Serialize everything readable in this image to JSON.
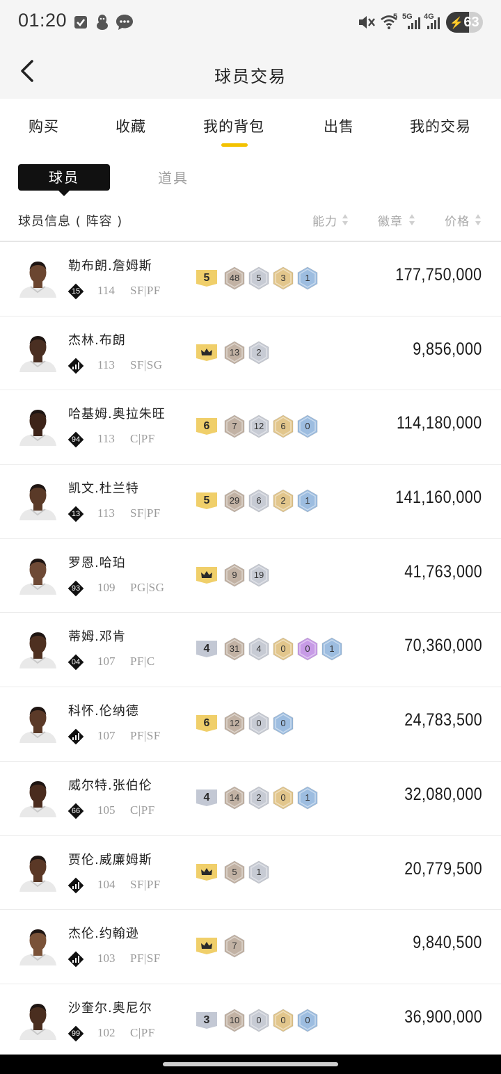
{
  "status_bar": {
    "time": "01:20",
    "battery": "63",
    "battery_level": 0.63,
    "net_5g": "5G",
    "net_4g": "4G",
    "wifi_badge": "5",
    "icons": [
      "checkbox-icon",
      "penguin-icon",
      "chat-icon",
      "mute-icon",
      "wifi-icon",
      "signal-5g-icon",
      "signal-4g-icon",
      "battery-charging-icon"
    ]
  },
  "header": {
    "title": "球员交易",
    "back_icon": "chevron-left-icon"
  },
  "tabs": [
    {
      "label": "购买"
    },
    {
      "label": "收藏"
    },
    {
      "label": "我的背包",
      "active": true
    },
    {
      "label": "出售"
    },
    {
      "label": "我的交易"
    }
  ],
  "sub_tabs": [
    {
      "label": "球员",
      "active": true
    },
    {
      "label": "道具"
    }
  ],
  "list_header": {
    "info": "球员信息 ( 阵容 )",
    "ability": "能力",
    "badge": "徽章",
    "price": "价格"
  },
  "colors": {
    "accent": "#f3c200",
    "level_gold": "#f0cf6a",
    "level_silver": "#c3c8d4",
    "hex_bronze": "#c2b2a4",
    "hex_silver": "#c7cbd4",
    "hex_gold": "#e2c68c",
    "hex_purple": "#c79be6",
    "hex_blue": "#9dbde0"
  },
  "players": [
    {
      "name": "勒布朗.詹姆斯",
      "jersey": "15",
      "ability": "114",
      "positions": "SF|PF",
      "level": "5",
      "level_type": "gold",
      "badges": [
        {
          "v": "48",
          "c": "bronze"
        },
        {
          "v": "5",
          "c": "silver"
        },
        {
          "v": "3",
          "c": "gold"
        },
        {
          "v": "1",
          "c": "blue"
        }
      ],
      "price": "177,750,000",
      "skin": "#6b4630"
    },
    {
      "name": "杰林.布朗",
      "jersey": "",
      "ability": "113",
      "positions": "SF|SG",
      "level": "",
      "level_type": "crown",
      "badges": [
        {
          "v": "13",
          "c": "bronze"
        },
        {
          "v": "2",
          "c": "silver"
        }
      ],
      "price": "9,856,000",
      "skin": "#4a2f22"
    },
    {
      "name": "哈基姆.奥拉朱旺",
      "jersey": "94",
      "ability": "113",
      "positions": "C|PF",
      "level": "6",
      "level_type": "gold",
      "badges": [
        {
          "v": "7",
          "c": "bronze"
        },
        {
          "v": "12",
          "c": "silver"
        },
        {
          "v": "6",
          "c": "gold"
        },
        {
          "v": "0",
          "c": "blue"
        }
      ],
      "price": "114,180,000",
      "skin": "#3d2419"
    },
    {
      "name": "凯文.杜兰特",
      "jersey": "13",
      "ability": "113",
      "positions": "SF|PF",
      "level": "5",
      "level_type": "gold",
      "badges": [
        {
          "v": "29",
          "c": "bronze"
        },
        {
          "v": "6",
          "c": "silver"
        },
        {
          "v": "2",
          "c": "gold"
        },
        {
          "v": "1",
          "c": "blue"
        }
      ],
      "price": "141,160,000",
      "skin": "#5a3a28"
    },
    {
      "name": "罗恩.哈珀",
      "jersey": "93",
      "ability": "109",
      "positions": "PG|SG",
      "level": "",
      "level_type": "crown",
      "badges": [
        {
          "v": "9",
          "c": "bronze"
        },
        {
          "v": "19",
          "c": "silver"
        }
      ],
      "price": "41,763,000",
      "skin": "#6e4a36"
    },
    {
      "name": "蒂姆.邓肯",
      "jersey": "04",
      "ability": "107",
      "positions": "PF|C",
      "level": "4",
      "level_type": "silver",
      "badges": [
        {
          "v": "31",
          "c": "bronze"
        },
        {
          "v": "4",
          "c": "silver"
        },
        {
          "v": "0",
          "c": "gold"
        },
        {
          "v": "0",
          "c": "purple"
        },
        {
          "v": "1",
          "c": "blue"
        }
      ],
      "price": "70,360,000",
      "skin": "#4e3020"
    },
    {
      "name": "科怀.伦纳德",
      "jersey": "",
      "ability": "107",
      "positions": "PF|SF",
      "level": "6",
      "level_type": "gold",
      "badges": [
        {
          "v": "12",
          "c": "bronze"
        },
        {
          "v": "0",
          "c": "silver"
        },
        {
          "v": "0",
          "c": "blue"
        }
      ],
      "price": "24,783,500",
      "skin": "#5b3a28"
    },
    {
      "name": "威尔特.张伯伦",
      "jersey": "66",
      "ability": "105",
      "positions": "C|PF",
      "level": "4",
      "level_type": "silver",
      "badges": [
        {
          "v": "14",
          "c": "bronze"
        },
        {
          "v": "2",
          "c": "silver"
        },
        {
          "v": "0",
          "c": "gold"
        },
        {
          "v": "1",
          "c": "blue"
        }
      ],
      "price": "32,080,000",
      "skin": "#4a2c1e"
    },
    {
      "name": "贾伦.威廉姆斯",
      "jersey": "",
      "ability": "104",
      "positions": "SF|PF",
      "level": "",
      "level_type": "crown",
      "badges": [
        {
          "v": "5",
          "c": "bronze"
        },
        {
          "v": "1",
          "c": "silver"
        }
      ],
      "price": "20,779,500",
      "skin": "#5a3826"
    },
    {
      "name": "杰伦.约翰逊",
      "jersey": "",
      "ability": "103",
      "positions": "PF|SF",
      "level": "",
      "level_type": "crown",
      "badges": [
        {
          "v": "7",
          "c": "bronze"
        }
      ],
      "price": "9,840,500",
      "skin": "#7a5238"
    },
    {
      "name": "沙奎尔.奥尼尔",
      "jersey": "99",
      "ability": "102",
      "positions": "C|PF",
      "level": "3",
      "level_type": "silver",
      "badges": [
        {
          "v": "10",
          "c": "bronze"
        },
        {
          "v": "0",
          "c": "silver"
        },
        {
          "v": "0",
          "c": "gold"
        },
        {
          "v": "0",
          "c": "blue"
        }
      ],
      "price": "36,900,000",
      "skin": "#4a2e1f"
    }
  ]
}
